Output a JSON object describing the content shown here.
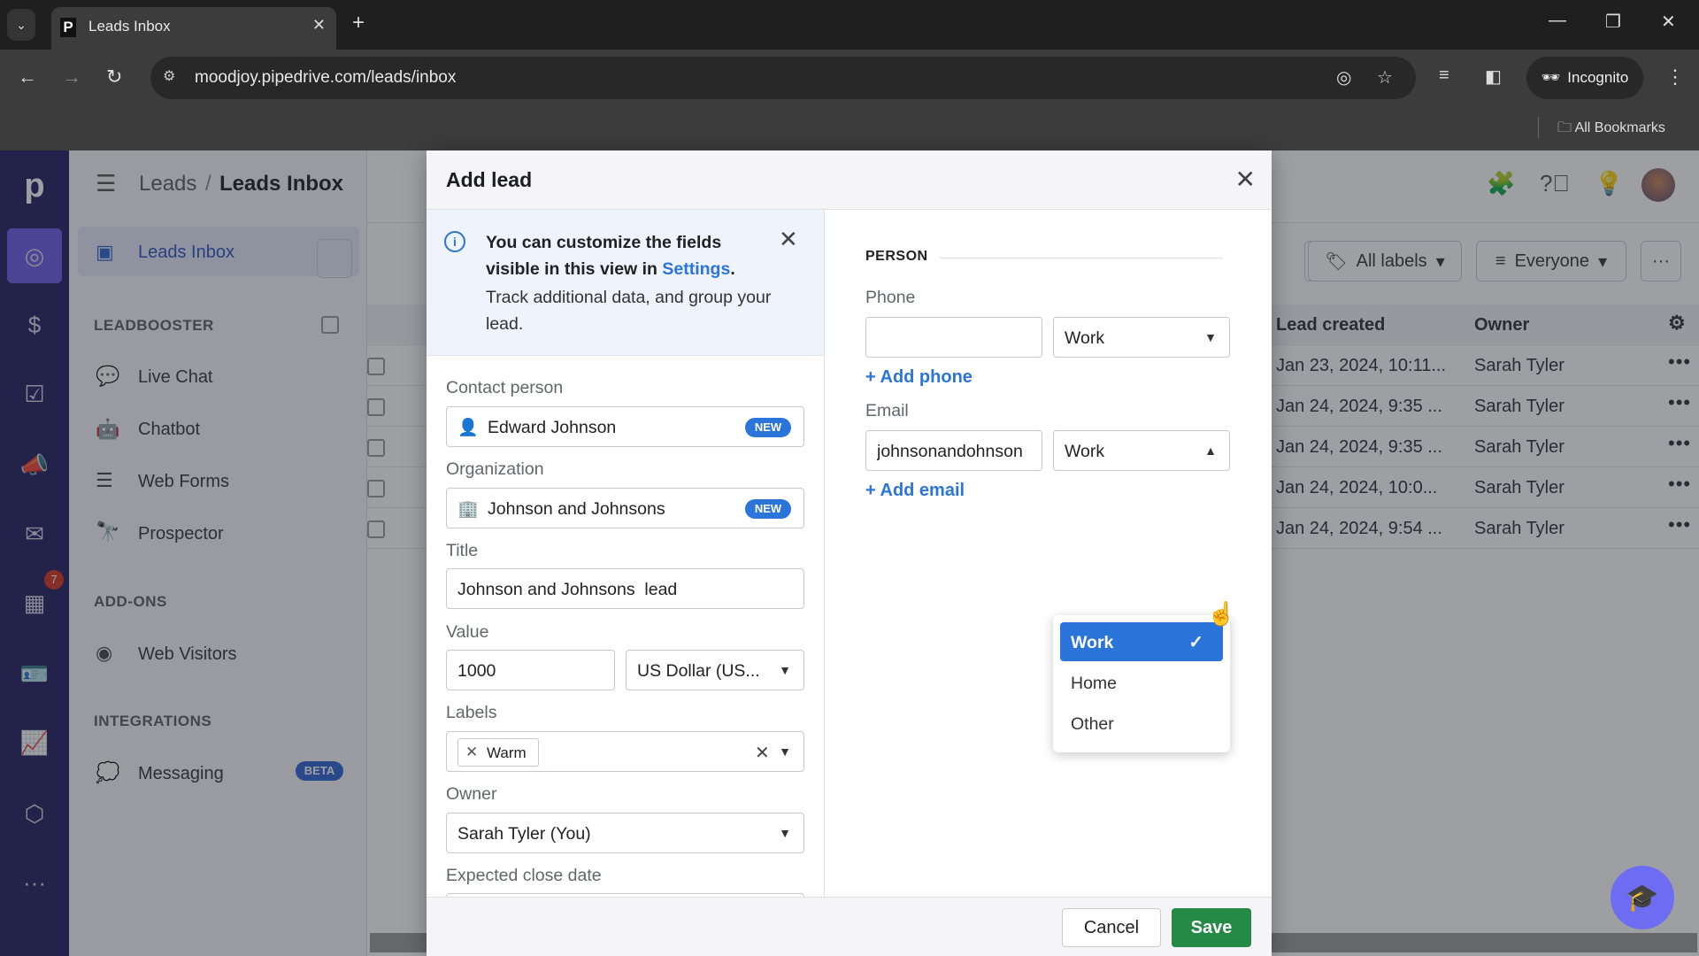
{
  "browser": {
    "tab_title": "Leads Inbox",
    "tab_favicon": "P",
    "url": "moodjoy.pipedrive.com/leads/inbox",
    "incognito_label": "Incognito",
    "bookmarks_label": "All Bookmarks"
  },
  "rail": {
    "logo": "p",
    "icons": [
      "leads-icon",
      "deals-icon",
      "tasks-icon",
      "campaigns-icon",
      "mail-icon",
      "calendar-icon",
      "contacts-icon",
      "insights-icon",
      "products-icon",
      "more-icon"
    ],
    "calendar_badge": "7"
  },
  "header": {
    "breadcrumb_parent": "Leads",
    "breadcrumb_sep": "/",
    "breadcrumb_current": "Leads Inbox"
  },
  "sidebar": {
    "active_item": "Leads Inbox",
    "sections": [
      {
        "title": "LEADBOOSTER",
        "items": [
          "Live Chat",
          "Chatbot",
          "Web Forms",
          "Prospector"
        ]
      },
      {
        "title": "ADD-ONS",
        "items": [
          "Web Visitors"
        ]
      },
      {
        "title": "INTEGRATIONS",
        "items": [
          "Messaging"
        ]
      }
    ],
    "messaging_badge": "BETA"
  },
  "filters": {
    "labels": "All labels",
    "owner": "Everyone",
    "more": "···"
  },
  "grid": {
    "columns": [
      "Lead created",
      "Owner"
    ],
    "rows": [
      {
        "created": "Jan 23, 2024, 10:11...",
        "owner": "Sarah Tyler"
      },
      {
        "created": "Jan 24, 2024, 9:35 ...",
        "owner": "Sarah Tyler"
      },
      {
        "created": "Jan 24, 2024, 9:35 ...",
        "owner": "Sarah Tyler"
      },
      {
        "created": "Jan 24, 2024, 10:0...",
        "owner": "Sarah Tyler"
      },
      {
        "created": "Jan 24, 2024, 9:54 ...",
        "owner": "Sarah Tyler"
      }
    ]
  },
  "modal": {
    "title": "Add lead",
    "info": {
      "line1_prefix": "You can customize the fields visible in this view in ",
      "settings_link": "Settings",
      "line1_suffix": ".",
      "line2": "Track additional data, and group your lead."
    },
    "fields": {
      "contact_label": "Contact person",
      "contact_value": "Edward Johnson",
      "contact_badge": "NEW",
      "org_label": "Organization",
      "org_value": "Johnson and Johnsons",
      "org_badge": "NEW",
      "title_label": "Title",
      "title_value": "Johnson and Johnsons  lead",
      "value_label": "Value",
      "value_amount": "1000",
      "value_currency": "US Dollar (US...",
      "labels_label": "Labels",
      "labels_chip": "Warm",
      "owner_label": "Owner",
      "owner_value": "Sarah Tyler (You)",
      "close_date_label": "Expected close date"
    },
    "person": {
      "section_title": "PERSON",
      "phone_label": "Phone",
      "phone_value": "",
      "phone_type": "Work",
      "add_phone": "+ Add phone",
      "email_label": "Email",
      "email_value": "johnsonandohnson",
      "email_type": "Work",
      "add_email": "+ Add email"
    },
    "email_type_menu": {
      "options": [
        "Work",
        "Home",
        "Other"
      ],
      "selected": "Work"
    },
    "cancel_label": "Cancel",
    "save_label": "Save"
  }
}
